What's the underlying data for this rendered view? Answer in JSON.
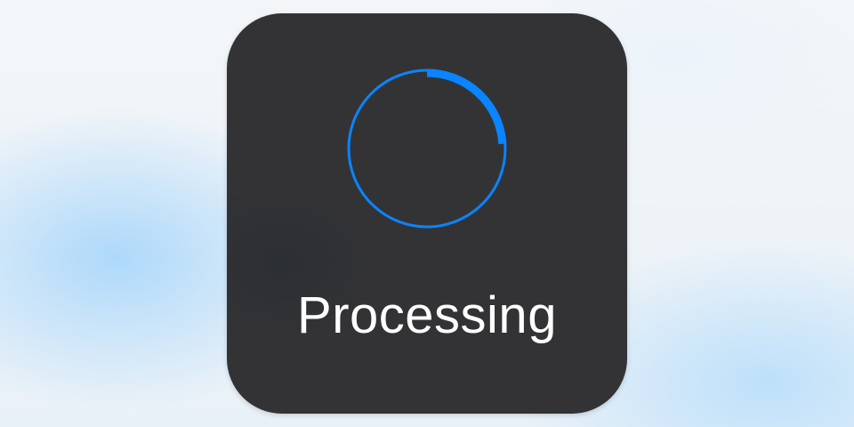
{
  "hud": {
    "status_text": "Processing"
  },
  "spinner": {
    "icon": "progress-ring-icon",
    "progress": 0.24,
    "ring_color": "#0a84ff",
    "arc_color": "#0a84ff"
  },
  "colors": {
    "hud_background": "#333335",
    "text": "#ffffff",
    "accent": "#0a84ff"
  }
}
